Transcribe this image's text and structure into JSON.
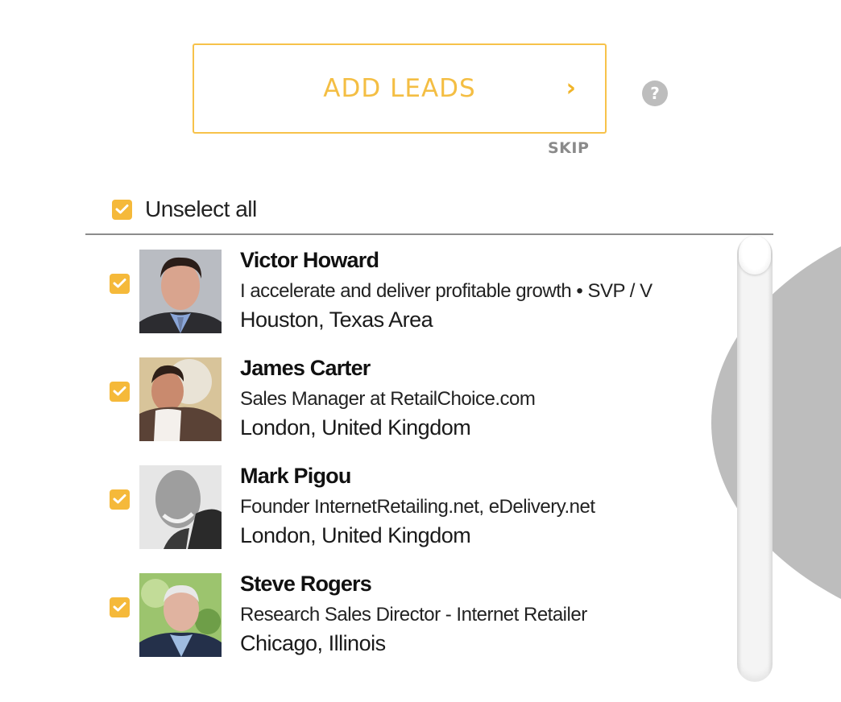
{
  "add_leads_button": {
    "label": "ADD LEADS",
    "icon": "chevron-right-icon",
    "glyph": "›"
  },
  "help_icon_glyph": "?",
  "skip_link": "SKIP",
  "select_all": {
    "label": "Unselect all",
    "checked": true
  },
  "colors": {
    "accent": "#f5b93a",
    "accent_text": "#f4be43",
    "help_gray": "#bdbdbd",
    "divider": "#8c8c8c"
  },
  "leads": [
    {
      "name": "Victor Howard",
      "headline": "I accelerate and deliver profitable growth • SVP / V",
      "location": "Houston, Texas Area",
      "checked": true
    },
    {
      "name": "James Carter",
      "headline": "Sales Manager at RetailChoice.com",
      "location": "London, United Kingdom",
      "checked": true
    },
    {
      "name": "Mark Pigou",
      "headline": "Founder InternetRetailing.net, eDelivery.net",
      "location": "London, United Kingdom",
      "checked": true
    },
    {
      "name": "Steve Rogers",
      "headline": "Research Sales Director - Internet Retailer",
      "location": "Chicago, Illinois",
      "checked": true
    }
  ]
}
